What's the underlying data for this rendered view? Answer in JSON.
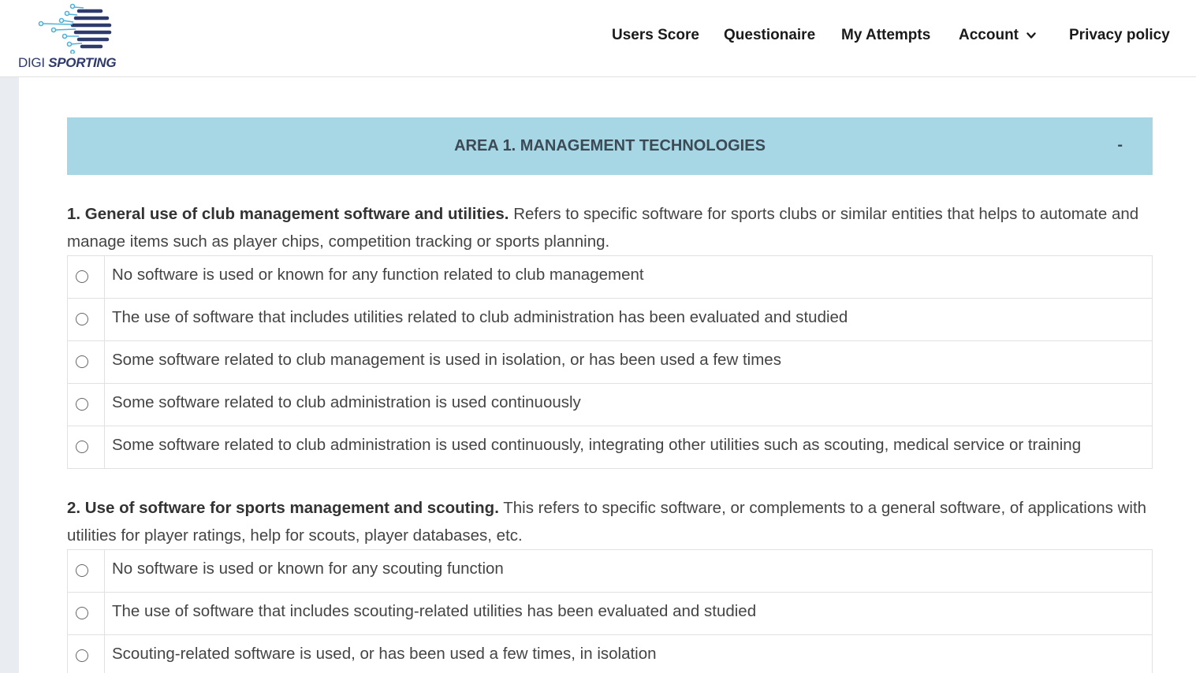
{
  "brand": {
    "name_part1": "DIGI",
    "name_part2": "SPORTING"
  },
  "nav": {
    "items": [
      {
        "label": "Users Score"
      },
      {
        "label": "Questionaire"
      },
      {
        "label": "My Attempts"
      },
      {
        "label": "Account",
        "icon": "chevron-down-icon"
      },
      {
        "label": "Privacy policy"
      }
    ]
  },
  "area": {
    "title": "AREA 1. MANAGEMENT TECHNOLOGIES",
    "toggle": "-"
  },
  "questions": [
    {
      "heading": "1. General use of club management software and utilities.",
      "description": "Refers to specific software for sports clubs or similar entities that helps to automate and manage items such as player chips, competition tracking or sports planning.",
      "options": [
        "No software is used or known for any function related to club management",
        "The use of software that includes utilities related to club administration has been evaluated and studied",
        "Some software related to club management is used in isolation, or has been used a few times",
        "Some software related to club administration is used continuously",
        "Some software related to club administration is used continuously, integrating other utilities such as scouting, medical service or training"
      ]
    },
    {
      "heading": "2. Use of software for sports management and scouting.",
      "description": "This refers to specific software, or complements to a general software, of applications with utilities for player ratings, help for scouts, player databases, etc.",
      "options": [
        "No software is used or known for any scouting function",
        "The use of software that includes scouting-related utilities has been evaluated and studied",
        "Scouting-related software is used, or has been used a few times, in isolation"
      ]
    }
  ],
  "colors": {
    "area_bar": "#a7d6e4",
    "logo_blue": "#2d3a6b",
    "logo_cyan": "#4fb3d9"
  }
}
